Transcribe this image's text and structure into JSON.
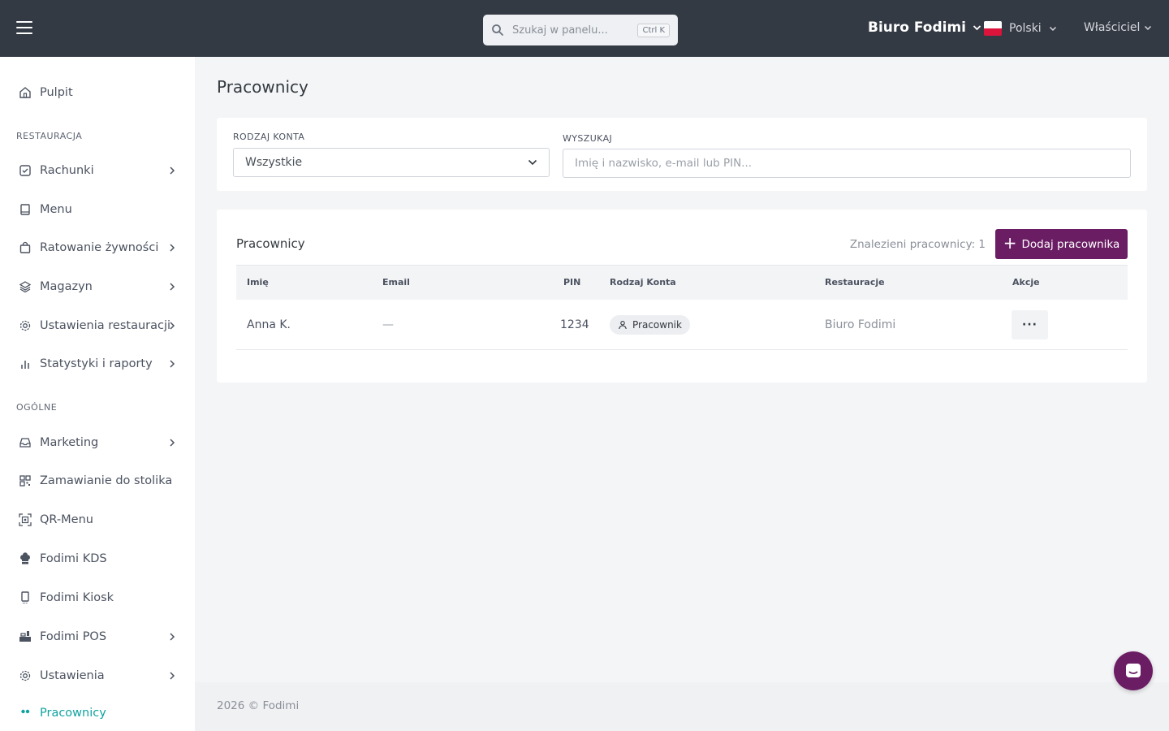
{
  "header": {
    "search_placeholder": "Szukaj w panelu...",
    "search_shortcut": "Ctrl K",
    "organization": "Biuro Fodimi",
    "language": "Polski",
    "role": "Właściciel"
  },
  "sidebar": {
    "pulpit": "Pulpit",
    "section_restaurant": "RESTAURACJA",
    "section_general": "OGÓLNE",
    "items": {
      "rachunki": "Rachunki",
      "menu": "Menu",
      "ratowanie": "Ratowanie żywności",
      "magazyn": "Magazyn",
      "ustawienia_restauracji": "Ustawienia restauracji",
      "statystyki": "Statystyki i raporty",
      "marketing": "Marketing",
      "zamawianie": "Zamawianie do stolika",
      "qrmenu": "QR-Menu",
      "kds": "Fodimi KDS",
      "kiosk": "Fodimi Kiosk",
      "pos": "Fodimi POS",
      "ustawienia": "Ustawienia",
      "pracownicy": "Pracownicy"
    }
  },
  "page": {
    "title": "Pracownicy"
  },
  "filters": {
    "account_type_label": "RODZAJ KONTA",
    "account_type_value": "Wszystkie",
    "search_label": "WYSZUKAJ",
    "search_placeholder": "Imię i nazwisko, e-mail lub PIN..."
  },
  "table": {
    "title": "Pracownicy",
    "count_text": "Znalezieni pracownicy: 1",
    "add_button": "Dodaj pracownika",
    "columns": {
      "name": "Imię",
      "email": "Email",
      "pin": "PIN",
      "account_type": "Rodzaj Konta",
      "restaurants": "Restauracje",
      "actions": "Akcje"
    },
    "rows": [
      {
        "name": "Anna K.",
        "email": "—",
        "pin": "1234",
        "account_type": "Pracownik",
        "restaurants": "Biuro Fodimi",
        "actions": "···"
      }
    ]
  },
  "footer": {
    "text": "2026 © Fodimi"
  },
  "colors": {
    "topbar": "#343a44",
    "accent": "#6b1d64",
    "active_nav": "#0fa3a0"
  }
}
